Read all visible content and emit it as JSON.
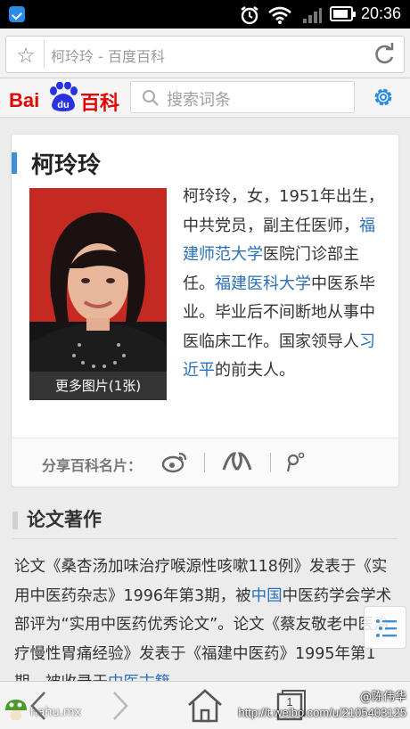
{
  "status_bar": {
    "time": "20:36"
  },
  "browser": {
    "page_title": "柯玲玲 - 百度百科"
  },
  "header": {
    "logo": {
      "bai": "Bai",
      "du": "du",
      "baike": "百科"
    },
    "search_placeholder": "搜索词条"
  },
  "card": {
    "name": "柯玲玲",
    "photo_caption": "更多图片(1张)",
    "bio": {
      "t1": "柯玲玲，女，1951年出生，中共党员，副主任医师，",
      "l1": "福建师范大学",
      "t2": "医院门诊部主任。",
      "l2": "福建医科大学",
      "t3": "中医系毕业。毕业后不间断地从事中医临床工作。国家领导人",
      "l3": "习近平",
      "t4": "的前夫人。"
    },
    "share_label": "分享百科名片："
  },
  "section": {
    "title": "论文著作",
    "para": {
      "t1": "论文《桑杏汤加味治疗喉源性咳嗽118例》发表于《实用中医药杂志》1996年第3期，被",
      "l1": "中国",
      "t2": "中医药学会学术部评为“实用中医药优秀论文”。论文《蔡友敬老中医治疗慢性胃痛经验》发表于《福建中医药》1995年第1期，被收录于",
      "l2": "中医古籍"
    }
  },
  "bottom_bar": {
    "tab_count": "1",
    "watermark_left": "hahu.mx",
    "watermark_handle": "@陈伟华",
    "watermark_url": "http://t.weibo.com/u/2105403125"
  },
  "colors": {
    "baidu_red": "#e10601",
    "baidu_blue": "#2a6fb7",
    "accent_blue": "#3d8fd7"
  }
}
